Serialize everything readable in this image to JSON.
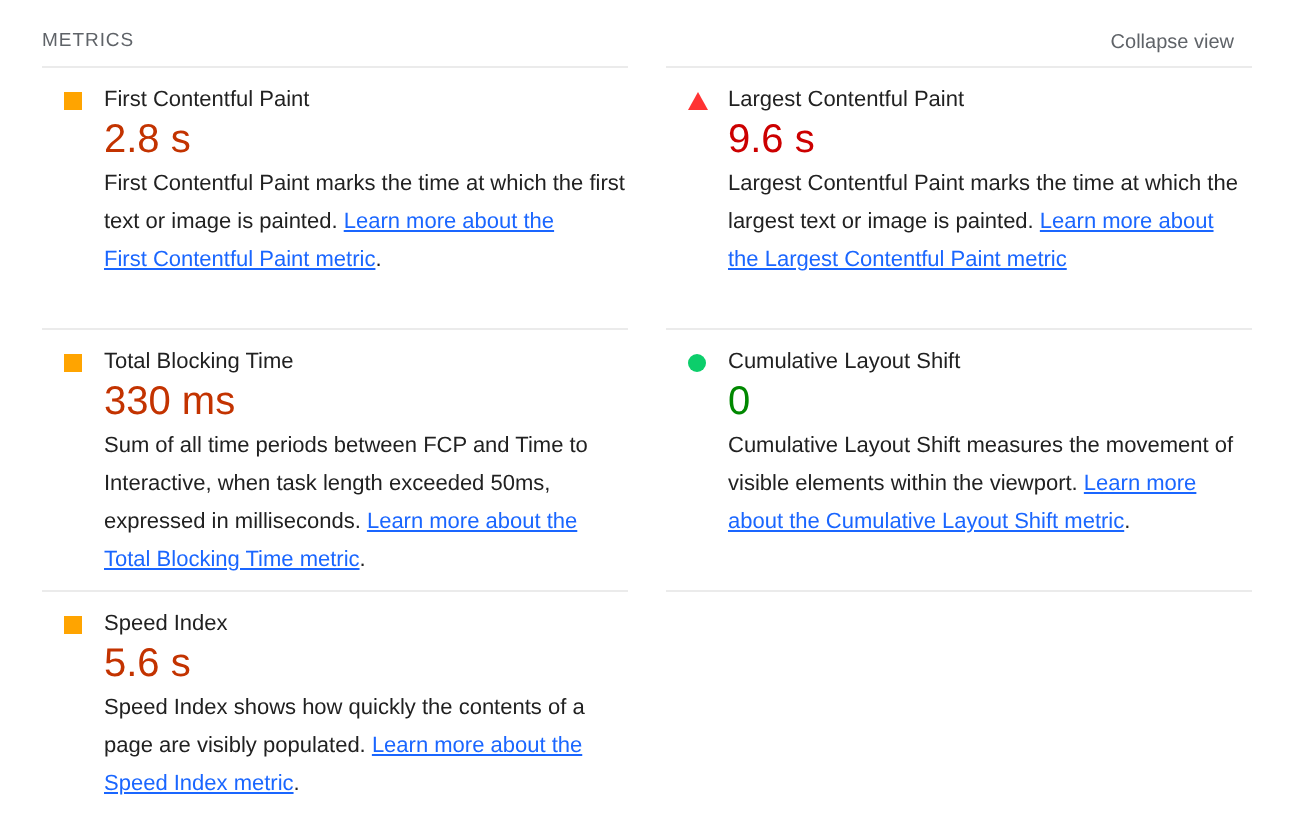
{
  "header": {
    "title": "METRICS",
    "toggle": "Collapse view"
  },
  "metrics": [
    {
      "kind": "average",
      "title": "First Contentful Paint",
      "value": "2.8 s",
      "description": "First Contentful Paint marks the time at which the first text or image is painted.",
      "link_lines": [
        "Learn more about the",
        "First Contentful Paint metric"
      ],
      "after": "."
    },
    {
      "kind": "fail",
      "title": "Largest Contentful Paint",
      "value": "9.6 s",
      "description": "Largest Contentful Paint marks the time at which the largest text or image is painted.",
      "link_lines": [
        "Learn more about",
        "the Largest Contentful Paint metric"
      ]
    },
    {
      "kind": "average",
      "title": "Total Blocking Time",
      "value": "330 ms",
      "description": "Sum of all time periods between FCP and Time to Interactive, when task length exceeded 50ms, expressed in milliseconds.",
      "link_lines": [
        "Learn more about the",
        "Total Blocking Time metric"
      ],
      "after": "."
    },
    {
      "kind": "pass",
      "title": "Cumulative Layout Shift",
      "value": "0",
      "description": "Cumulative Layout Shift measures the movement of visible elements within the viewport.",
      "link_lines": [
        "Learn more",
        "about the Cumulative Layout Shift metric"
      ],
      "after": "."
    },
    {
      "kind": "average",
      "title": "Speed Index",
      "value": "5.6 s",
      "description": "Speed Index shows how quickly the contents of a page are visibly populated.",
      "link_lines": [
        "Learn more about the",
        "Speed Index metric"
      ],
      "after": "."
    }
  ]
}
